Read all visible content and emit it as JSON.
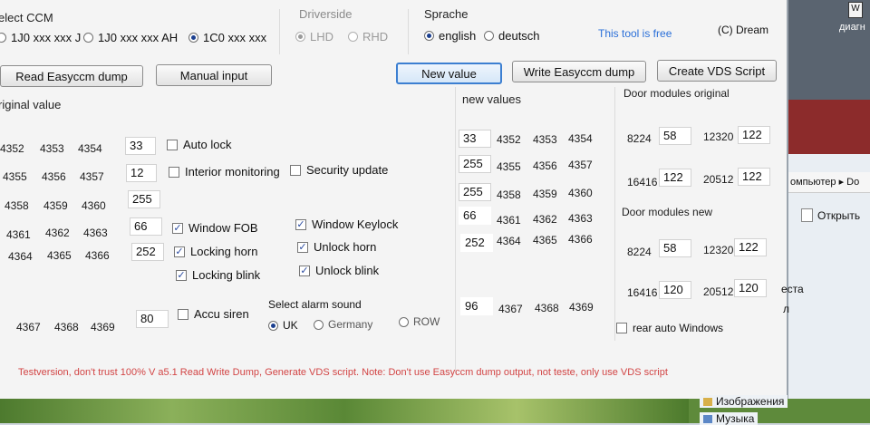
{
  "ccm": {
    "title": "elect CCM",
    "options": [
      "1J0 xxx xxx J",
      "1J0 xxx xxx AH",
      "1C0 xxx xxx"
    ],
    "selected": "1C0 xxx xxx"
  },
  "driverside": {
    "title": "Driverside",
    "options": [
      "LHD",
      "RHD"
    ],
    "selected": "LHD"
  },
  "sprache": {
    "title": "Sprache",
    "options": [
      "english",
      "deutsch"
    ],
    "selected": "english"
  },
  "free_link": "This tool is free",
  "copyright": "(C) Dream",
  "buttons": {
    "read_dump": "Read Easyccm dump",
    "manual_input": "Manual input",
    "new_value": "New value",
    "write_dump": "Write Easyccm dump",
    "create_vds": "Create VDS Script"
  },
  "original": {
    "title": "riginal value",
    "rows": [
      {
        "addrs": [
          "4352",
          "4353",
          "4354"
        ],
        "value": "33"
      },
      {
        "addrs": [
          "4355",
          "4356",
          "4357"
        ],
        "value": "12"
      },
      {
        "addrs": [
          "4358",
          "4359",
          "4360"
        ],
        "value": "255"
      },
      {
        "addrs": [
          "4361",
          "4362",
          "4363"
        ],
        "value": "66"
      },
      {
        "addrs": [
          "4364",
          "4365",
          "4366"
        ],
        "value": "252"
      },
      {
        "addrs": [
          "4367",
          "4368",
          "4369"
        ],
        "value": "80"
      }
    ]
  },
  "checks": {
    "auto_lock": "Auto lock",
    "interior_monitoring": "Interior monitoring",
    "security_update": "Security update",
    "window_fob": "Window FOB",
    "window_keylock": "Window Keylock",
    "locking_horn": "Locking horn",
    "unlock_horn": "Unlock horn",
    "locking_blink": "Locking blink",
    "unlock_blink": "Unlock blink",
    "accu_siren": "Accu siren",
    "rear_auto_windows": "rear auto Windows"
  },
  "alarm": {
    "title": "Select alarm sound",
    "options": [
      "UK",
      "Germany",
      "ROW"
    ],
    "selected": "UK"
  },
  "new_values": {
    "title": "new values",
    "rows": [
      {
        "value": "33",
        "addrs": [
          "4352",
          "4353",
          "4354"
        ]
      },
      {
        "value": "255",
        "addrs": [
          "4355",
          "4356",
          "4357"
        ]
      },
      {
        "value": "255",
        "addrs": [
          "4358",
          "4359",
          "4360"
        ]
      },
      {
        "value": "66",
        "addrs": [
          "4361",
          "4362",
          "4363"
        ]
      },
      {
        "value": "252",
        "addrs": [
          "4364",
          "4365",
          "4366"
        ]
      },
      {
        "value": "96",
        "addrs": [
          "4367",
          "4368",
          "4369"
        ]
      }
    ]
  },
  "door_orig": {
    "title": "Door modules original",
    "items": [
      {
        "addr": "8224",
        "value": "58"
      },
      {
        "addr": "12320",
        "value": "122"
      },
      {
        "addr": "16416",
        "value": "122"
      },
      {
        "addr": "20512",
        "value": "122"
      }
    ]
  },
  "door_new": {
    "title": "Door modules new",
    "items": [
      {
        "addr": "8224",
        "value": "58"
      },
      {
        "addr": "12320",
        "value": "122"
      },
      {
        "addr": "16416",
        "value": "120"
      },
      {
        "addr": "20512",
        "value": "120"
      }
    ]
  },
  "warning": "Testversion, don't trust 100% V a5.1 Read Write Dump, Generate VDS script. Note: Don't use Easyccm dump output, not teste, only use VDS script",
  "explorer": {
    "badge": "W",
    "top_text": "диагн",
    "breadcrumb": "омпьютер ▸ Do",
    "open": "Открыть",
    "side1": "еста",
    "side2": "л",
    "images": "Изображения",
    "music": "Музыка"
  }
}
